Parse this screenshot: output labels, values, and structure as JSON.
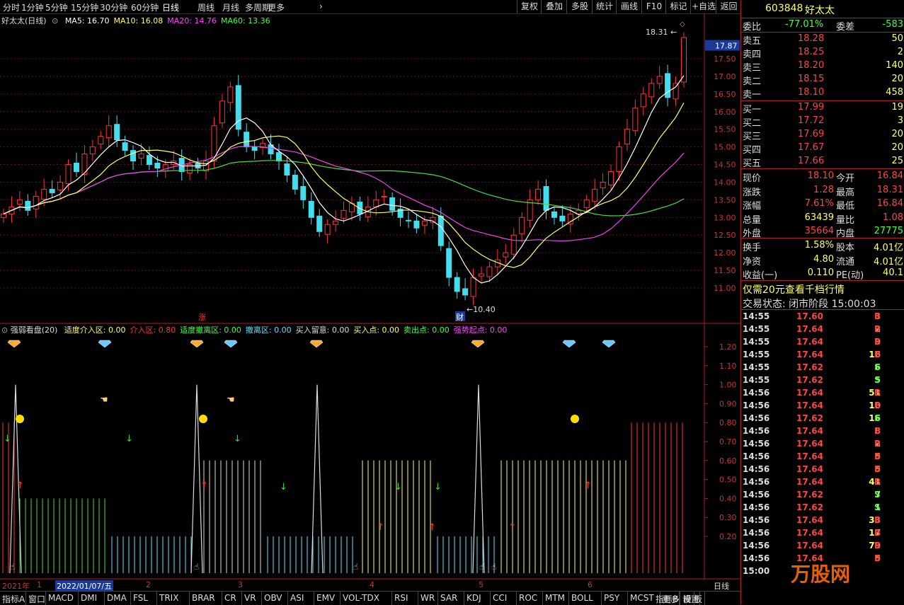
{
  "toolbar": {
    "periods": [
      "分时",
      "1分钟",
      "5分钟",
      "15分钟",
      "30分钟",
      "60分钟",
      "日线",
      "周线",
      "月线",
      "多周期",
      "更多"
    ],
    "active_period": "日线",
    "buttons": [
      "复权",
      "叠加",
      "多股",
      "统计",
      "画线",
      "F10",
      "标记",
      "+自选",
      "返回"
    ]
  },
  "main": {
    "title": "好太太(日线)",
    "ma": [
      {
        "label": "MA5: 16.70",
        "color": "#ffffff"
      },
      {
        "label": "MA10: 16.08",
        "color": "#ffff66"
      },
      {
        "label": "MA20: 14.76",
        "color": "#ff44ff"
      },
      {
        "label": "MA60: 13.36",
        "color": "#44ff44"
      }
    ],
    "price_ticks": [
      "17.50",
      "17.00",
      "16.50",
      "16.00",
      "15.50",
      "15.00",
      "14.50",
      "14.00",
      "13.50",
      "13.00",
      "12.50",
      "12.00",
      "11.50",
      "11.00"
    ],
    "current_price_tag": "17.87",
    "high_label": "18.31",
    "low_label": "10.40",
    "marker_zhang": "涨",
    "marker_cai": "财"
  },
  "sub": {
    "title": "强弱看盘(20)",
    "items": [
      {
        "label": "适度介入区: 0.00",
        "color": "#ffff66"
      },
      {
        "label": "介入区: 0.80",
        "color": "#ff3333"
      },
      {
        "label": "适度撤离区: 0.00",
        "color": "#44ff44"
      },
      {
        "label": "撤离区: 0.00",
        "color": "#66ddff"
      },
      {
        "label": "买入留意: 0.00",
        "color": "#dddddd"
      },
      {
        "label": "买入点: 0.00",
        "color": "#ffff66"
      },
      {
        "label": "卖出点: 0.00",
        "color": "#44ff44"
      },
      {
        "label": "强势起点: 0.00",
        "color": "#ff44ff"
      }
    ],
    "ticks": [
      "1.20",
      "1.10",
      "1.00",
      "0.90",
      "0.80",
      "0.70",
      "0.60",
      "0.50",
      "0.40",
      "0.30",
      "0.20"
    ]
  },
  "date_axis": {
    "labels": [
      "2021年",
      "1",
      "2022/01/07/五",
      "2",
      "3",
      "4",
      "5",
      "6"
    ],
    "period": "日线"
  },
  "bottom_tabs": [
    "指标A",
    "窗口",
    "MACD",
    "DMI",
    "DMA",
    "FSL",
    "TRIX",
    "BRAR",
    "CR",
    "VR",
    "OBV",
    "ASI",
    "EMV",
    "VOL-TDX",
    "RSI",
    "WR",
    "SAR",
    "KDJ",
    "CCI",
    "ROC",
    "MTM",
    "BOLL",
    "PSY",
    "MCST",
    "更多",
    "设置",
    "指标B",
    "模",
    "板"
  ],
  "quote": {
    "code": "603848",
    "name": "好太太",
    "weibi_label": "委比",
    "weibi": "-77.01%",
    "weicha_label": "委差",
    "weicha": "-583",
    "asks": [
      {
        "label": "卖五",
        "price": "18.28",
        "vol": "50"
      },
      {
        "label": "卖四",
        "price": "18.25",
        "vol": "2"
      },
      {
        "label": "卖三",
        "price": "18.20",
        "vol": "140"
      },
      {
        "label": "卖二",
        "price": "18.15",
        "vol": "20"
      },
      {
        "label": "卖一",
        "price": "18.10",
        "vol": "458"
      }
    ],
    "bids": [
      {
        "label": "买一",
        "price": "17.99",
        "vol": "19"
      },
      {
        "label": "买二",
        "price": "17.72",
        "vol": "3"
      },
      {
        "label": "买三",
        "price": "17.69",
        "vol": "20"
      },
      {
        "label": "买四",
        "price": "17.67",
        "vol": "20"
      },
      {
        "label": "买五",
        "price": "17.66",
        "vol": "25"
      }
    ],
    "stats": [
      {
        "l1": "现价",
        "v1": "18.10",
        "l2": "今开",
        "v2": "16.84"
      },
      {
        "l1": "涨跌",
        "v1": "1.28",
        "l2": "最高",
        "v2": "18.31"
      },
      {
        "l1": "涨幅",
        "v1": "7.61%",
        "l2": "最低",
        "v2": "16.84"
      },
      {
        "l1": "总量",
        "v1": "63439",
        "l2": "量比",
        "v2": "1.08"
      },
      {
        "l1": "外盘",
        "v1": "35664",
        "l2": "内盘",
        "v2": "27775"
      }
    ],
    "stats2": [
      {
        "l1": "换手",
        "v1": "1.58%",
        "l2": "股本",
        "v2": "4.01亿"
      },
      {
        "l1": "净资",
        "v1": "4.80",
        "l2": "流通",
        "v2": "4.01亿"
      },
      {
        "l1": "收益(一)",
        "v1": "0.110",
        "l2": "PE(动)",
        "v2": "40.1"
      }
    ],
    "promo": "仅需20元查看千档行情",
    "status": "交易状态: 闭市阶段 15:00:03",
    "ticks": [
      {
        "t": "14:55",
        "p": "17.60",
        "v": "3",
        "d": "B"
      },
      {
        "t": "14:55",
        "p": "17.64",
        "v": "2",
        "d": "B"
      },
      {
        "t": "14:55",
        "p": "17.64",
        "v": "9",
        "d": "B"
      },
      {
        "t": "14:55",
        "p": "17.64",
        "v": "16",
        "d": "B"
      },
      {
        "t": "14:55",
        "p": "17.62",
        "v": "6",
        "d": "S"
      },
      {
        "t": "14:55",
        "p": "17.62",
        "v": "5",
        "d": "S"
      },
      {
        "t": "14:56",
        "p": "17.64",
        "v": "51",
        "d": "B"
      },
      {
        "t": "14:56",
        "p": "17.64",
        "v": "10",
        "d": "B"
      },
      {
        "t": "14:56",
        "p": "17.62",
        "v": "16",
        "d": "S"
      },
      {
        "t": "14:56",
        "p": "17.64",
        "v": "8",
        "d": "B"
      },
      {
        "t": "14:56",
        "p": "17.64",
        "v": "2",
        "d": "B"
      },
      {
        "t": "14:56",
        "p": "17.64",
        "v": "5",
        "d": "B"
      },
      {
        "t": "14:56",
        "p": "17.64",
        "v": "5",
        "d": "B"
      },
      {
        "t": "14:56",
        "p": "17.64",
        "v": "41",
        "d": "B"
      },
      {
        "t": "14:56",
        "p": "17.62",
        "v": "7",
        "d": "S"
      },
      {
        "t": "14:56",
        "p": "17.62",
        "v": "1",
        "d": "S"
      },
      {
        "t": "14:56",
        "p": "17.64",
        "v": "33",
        "d": "B"
      },
      {
        "t": "14:56",
        "p": "17.64",
        "v": "17",
        "d": "B"
      },
      {
        "t": "14:56",
        "p": "17.64",
        "v": "79",
        "d": "B"
      },
      {
        "t": "14:56",
        "p": "17.64",
        "v": "5",
        "d": "B"
      },
      {
        "t": "15:00",
        "p": "",
        "v": "",
        "d": ""
      }
    ],
    "watermark": "万股网"
  },
  "chart_data": {
    "type": "candlestick",
    "ylim": [
      10.4,
      18.31
    ],
    "closes": [
      13.1,
      13.3,
      13.5,
      13.2,
      13.6,
      13.8,
      13.7,
      14.0,
      14.5,
      14.3,
      14.8,
      15.0,
      15.3,
      15.6,
      15.2,
      14.9,
      14.6,
      14.8,
      14.5,
      14.4,
      14.5,
      14.6,
      14.3,
      14.5,
      14.4,
      14.6,
      15.6,
      16.3,
      16.7,
      15.5,
      15.0,
      14.9,
      15.1,
      14.8,
      14.6,
      14.2,
      13.8,
      13.5,
      13.0,
      12.6,
      12.8,
      12.9,
      13.2,
      13.4,
      13.1,
      13.3,
      13.5,
      13.6,
      13.2,
      13.0,
      12.9,
      12.7,
      12.9,
      13.0,
      12.2,
      11.3,
      10.9,
      10.8,
      11.3,
      11.4,
      11.6,
      11.8,
      12.0,
      12.5,
      13.0,
      13.5,
      13.8,
      13.2,
      13.0,
      12.9,
      13.1,
      13.2,
      13.5,
      13.8,
      14.0,
      14.3,
      15.0,
      15.5,
      16.1,
      16.5,
      16.8,
      17.0,
      16.4,
      16.8,
      18.1
    ]
  }
}
